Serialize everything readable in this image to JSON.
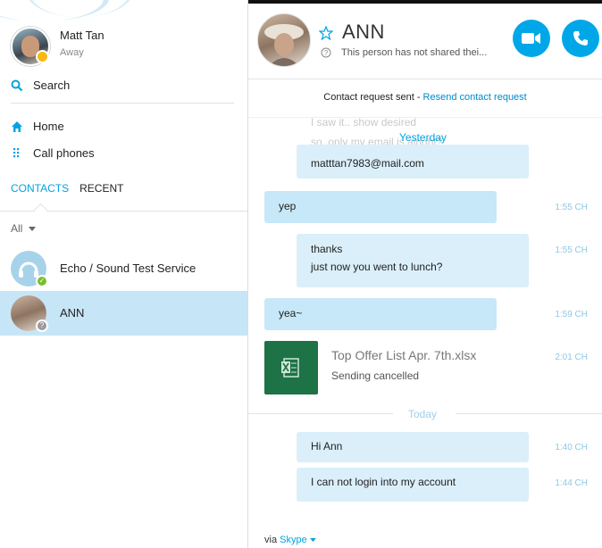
{
  "profile": {
    "name": "Matt Tan",
    "status": "Away"
  },
  "nav": {
    "search": "Search",
    "home": "Home",
    "call_phones": "Call phones"
  },
  "tabs": {
    "contacts": "CONTACTS",
    "recent": "RECENT"
  },
  "filter": "All",
  "contacts": [
    {
      "name": "Echo / Sound Test Service"
    },
    {
      "name": "ANN"
    }
  ],
  "chat": {
    "name": "ANN",
    "mood": "This person has not shared thei...",
    "request_text": "Contact request sent - ",
    "request_link": "Resend contact request",
    "yesterday": "Yesterday",
    "today": "Today",
    "ghost_lines": [
      "I saw it.. show desired",
      "so..only my email is alright?"
    ],
    "messages": [
      {
        "lines": [
          "matttan7983@mail.com"
        ],
        "time": ""
      },
      {
        "lines": [
          "yep"
        ],
        "time": "1:55 CH"
      },
      {
        "lines": [
          "thanks",
          "just now you went to lunch?"
        ],
        "time": "1:55 CH"
      },
      {
        "lines": [
          "yea~"
        ],
        "time": "1:59 CH"
      },
      {
        "lines": [
          "Hi Ann"
        ],
        "time": "1:40 CH"
      },
      {
        "lines": [
          "I can not login into my account"
        ],
        "time": "1:44 CH"
      }
    ],
    "file": {
      "name": "Top Offer List Apr. 7th.xlsx",
      "status": "Sending cancelled",
      "time": "2:01 CH"
    },
    "via_label": "via ",
    "via_link": "Skype"
  },
  "colors": {
    "accent": "#00a3e3",
    "selected": "#c6e6f7",
    "bubble": "#c7e8f8",
    "excel": "#1d7246"
  }
}
